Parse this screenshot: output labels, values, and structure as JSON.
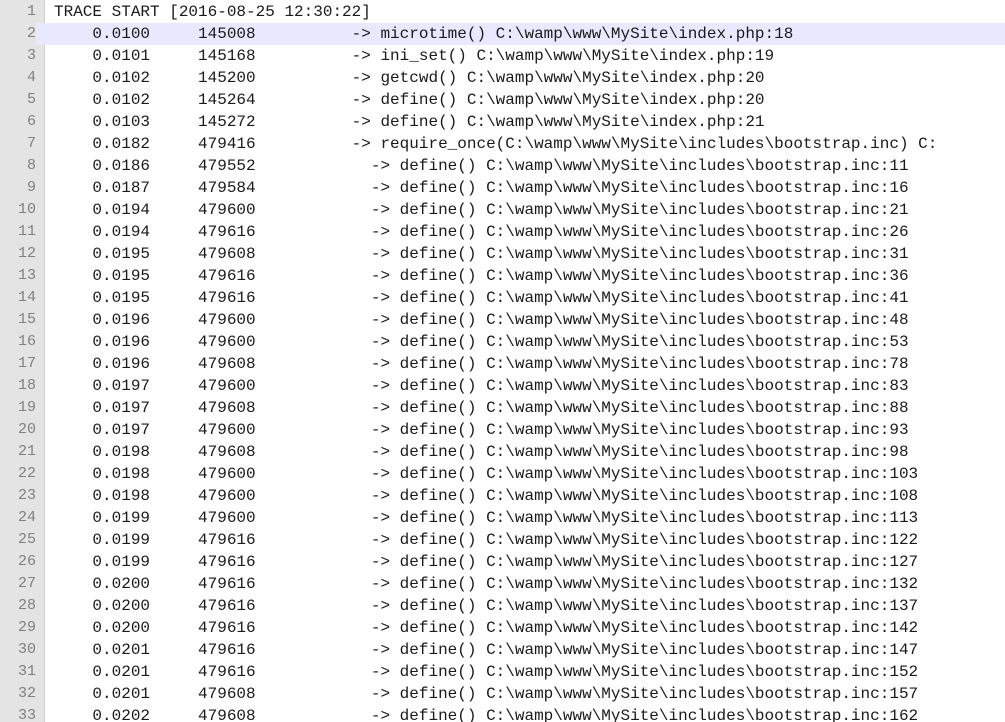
{
  "editor": {
    "current_line": 2,
    "lines": [
      {
        "number": "1",
        "text": "TRACE START [2016-08-25 12:30:22]"
      },
      {
        "number": "2",
        "text": "    0.0100     145008          -> microtime() C:\\wamp\\www\\MySite\\index.php:18"
      },
      {
        "number": "3",
        "text": "    0.0101     145168          -> ini_set() C:\\wamp\\www\\MySite\\index.php:19"
      },
      {
        "number": "4",
        "text": "    0.0102     145200          -> getcwd() C:\\wamp\\www\\MySite\\index.php:20"
      },
      {
        "number": "5",
        "text": "    0.0102     145264          -> define() C:\\wamp\\www\\MySite\\index.php:20"
      },
      {
        "number": "6",
        "text": "    0.0103     145272          -> define() C:\\wamp\\www\\MySite\\index.php:21"
      },
      {
        "number": "7",
        "text": "    0.0182     479416          -> require_once(C:\\wamp\\www\\MySite\\includes\\bootstrap.inc) C:"
      },
      {
        "number": "8",
        "text": "    0.0186     479552            -> define() C:\\wamp\\www\\MySite\\includes\\bootstrap.inc:11"
      },
      {
        "number": "9",
        "text": "    0.0187     479584            -> define() C:\\wamp\\www\\MySite\\includes\\bootstrap.inc:16"
      },
      {
        "number": "10",
        "text": "    0.0194     479600            -> define() C:\\wamp\\www\\MySite\\includes\\bootstrap.inc:21"
      },
      {
        "number": "11",
        "text": "    0.0194     479616            -> define() C:\\wamp\\www\\MySite\\includes\\bootstrap.inc:26"
      },
      {
        "number": "12",
        "text": "    0.0195     479608            -> define() C:\\wamp\\www\\MySite\\includes\\bootstrap.inc:31"
      },
      {
        "number": "13",
        "text": "    0.0195     479616            -> define() C:\\wamp\\www\\MySite\\includes\\bootstrap.inc:36"
      },
      {
        "number": "14",
        "text": "    0.0195     479616            -> define() C:\\wamp\\www\\MySite\\includes\\bootstrap.inc:41"
      },
      {
        "number": "15",
        "text": "    0.0196     479600            -> define() C:\\wamp\\www\\MySite\\includes\\bootstrap.inc:48"
      },
      {
        "number": "16",
        "text": "    0.0196     479600            -> define() C:\\wamp\\www\\MySite\\includes\\bootstrap.inc:53"
      },
      {
        "number": "17",
        "text": "    0.0196     479608            -> define() C:\\wamp\\www\\MySite\\includes\\bootstrap.inc:78"
      },
      {
        "number": "18",
        "text": "    0.0197     479600            -> define() C:\\wamp\\www\\MySite\\includes\\bootstrap.inc:83"
      },
      {
        "number": "19",
        "text": "    0.0197     479608            -> define() C:\\wamp\\www\\MySite\\includes\\bootstrap.inc:88"
      },
      {
        "number": "20",
        "text": "    0.0197     479600            -> define() C:\\wamp\\www\\MySite\\includes\\bootstrap.inc:93"
      },
      {
        "number": "21",
        "text": "    0.0198     479608            -> define() C:\\wamp\\www\\MySite\\includes\\bootstrap.inc:98"
      },
      {
        "number": "22",
        "text": "    0.0198     479600            -> define() C:\\wamp\\www\\MySite\\includes\\bootstrap.inc:103"
      },
      {
        "number": "23",
        "text": "    0.0198     479600            -> define() C:\\wamp\\www\\MySite\\includes\\bootstrap.inc:108"
      },
      {
        "number": "24",
        "text": "    0.0199     479600            -> define() C:\\wamp\\www\\MySite\\includes\\bootstrap.inc:113"
      },
      {
        "number": "25",
        "text": "    0.0199     479616            -> define() C:\\wamp\\www\\MySite\\includes\\bootstrap.inc:122"
      },
      {
        "number": "26",
        "text": "    0.0199     479616            -> define() C:\\wamp\\www\\MySite\\includes\\bootstrap.inc:127"
      },
      {
        "number": "27",
        "text": "    0.0200     479616            -> define() C:\\wamp\\www\\MySite\\includes\\bootstrap.inc:132"
      },
      {
        "number": "28",
        "text": "    0.0200     479616            -> define() C:\\wamp\\www\\MySite\\includes\\bootstrap.inc:137"
      },
      {
        "number": "29",
        "text": "    0.0200     479616            -> define() C:\\wamp\\www\\MySite\\includes\\bootstrap.inc:142"
      },
      {
        "number": "30",
        "text": "    0.0201     479616            -> define() C:\\wamp\\www\\MySite\\includes\\bootstrap.inc:147"
      },
      {
        "number": "31",
        "text": "    0.0201     479616            -> define() C:\\wamp\\www\\MySite\\includes\\bootstrap.inc:152"
      },
      {
        "number": "32",
        "text": "    0.0201     479608            -> define() C:\\wamp\\www\\MySite\\includes\\bootstrap.inc:157"
      },
      {
        "number": "33",
        "text": "    0.0202     479608            -> define() C:\\wamp\\www\\MySite\\includes\\bootstrap.inc:162"
      }
    ]
  }
}
